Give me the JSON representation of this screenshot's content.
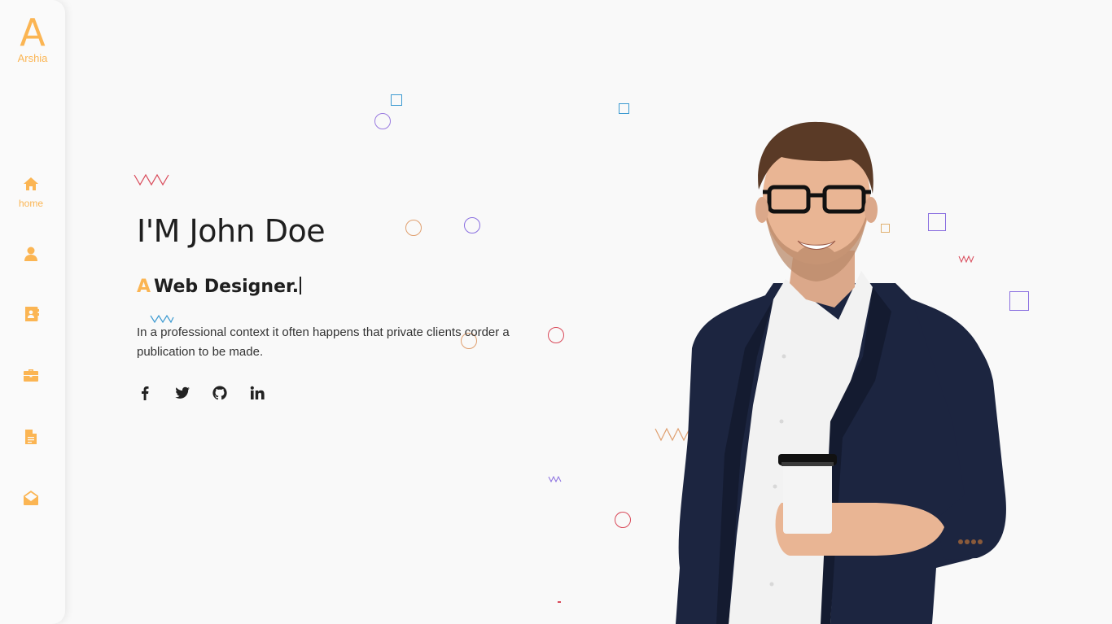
{
  "brand": {
    "mark": "A",
    "name": "Arshia"
  },
  "nav": {
    "items": [
      {
        "icon": "home-icon",
        "label": "home",
        "active": true
      },
      {
        "icon": "user-icon",
        "label": ""
      },
      {
        "icon": "contact-book-icon",
        "label": ""
      },
      {
        "icon": "briefcase-icon",
        "label": ""
      },
      {
        "icon": "document-icon",
        "label": ""
      },
      {
        "icon": "envelope-open-icon",
        "label": ""
      }
    ]
  },
  "hero": {
    "title": "I'M John Doe",
    "subtitle_prefix": "A",
    "subtitle": "Web Designer.",
    "description": "In a professional context it often happens that private clients corder a publication to be made."
  },
  "social": [
    {
      "icon": "facebook-icon"
    },
    {
      "icon": "twitter-icon"
    },
    {
      "icon": "github-icon"
    },
    {
      "icon": "linkedin-icon"
    }
  ],
  "colors": {
    "accent": "#fbb553",
    "background": "#f9f9f9",
    "text": "#1f1f1f",
    "jacket": "#1c2540",
    "shirt": "#f2f2f2",
    "skin": "#e9b594",
    "hair": "#5a3a26"
  }
}
